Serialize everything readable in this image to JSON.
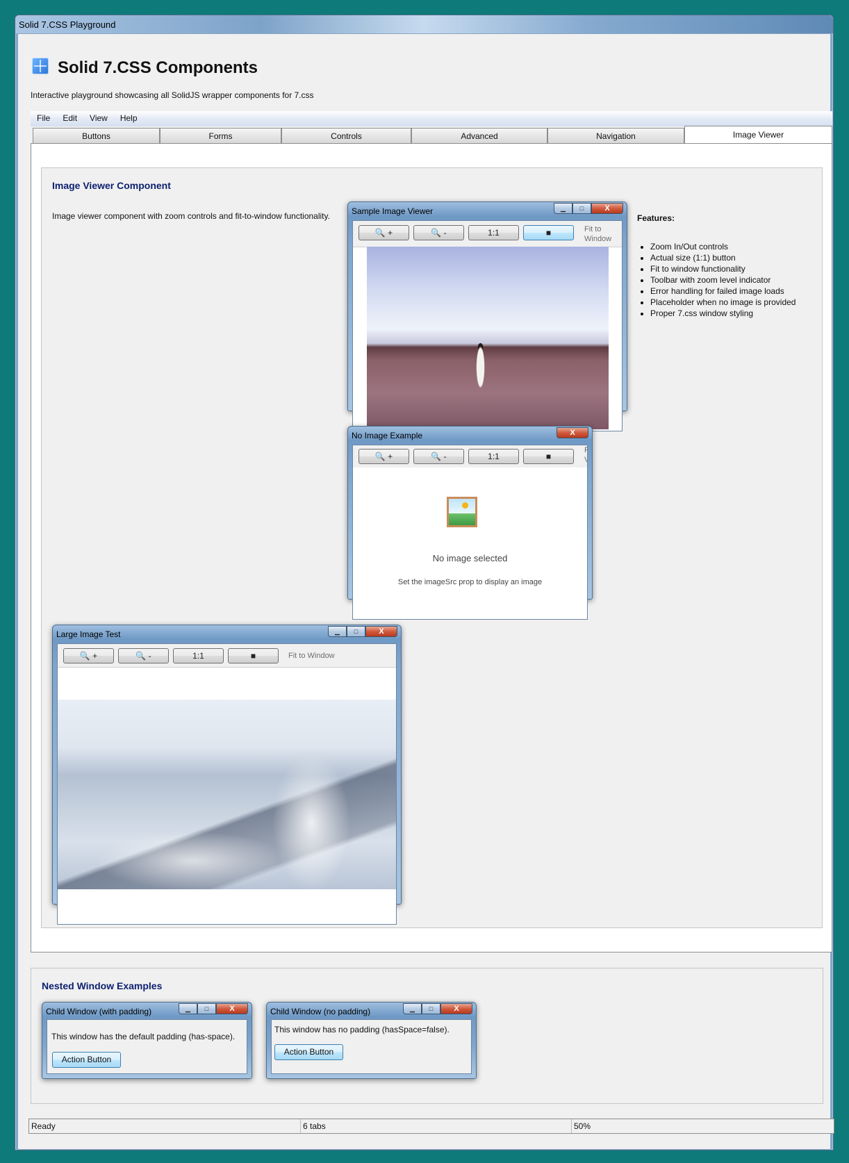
{
  "window": {
    "title": "Solid 7.CSS Playground"
  },
  "header": {
    "title": "Solid 7.CSS Components",
    "subtitle": "Interactive playground showcasing all SolidJS wrapper components for 7.css"
  },
  "menu": [
    "File",
    "Edit",
    "View",
    "Help"
  ],
  "tabs": [
    "Buttons",
    "Forms",
    "Controls",
    "Advanced",
    "Navigation",
    "Image Viewer"
  ],
  "active_tab": "Image Viewer",
  "image_viewer_section": {
    "title": "Image Viewer Component",
    "description": "Image viewer component with zoom controls and fit-to-window functionality."
  },
  "toolbar": {
    "zoom_in": "+",
    "zoom_out": "-",
    "actual_size": "1:1",
    "fit_icon": "■",
    "fit_label": "Fit to Window",
    "fit_label_wrap1": "Fit to",
    "fit_label_wrap2": "Window",
    "fit_trunc1": "F",
    "fit_trunc2": "V"
  },
  "windows": {
    "sample": {
      "title": "Sample Image Viewer"
    },
    "no_image": {
      "title": "No Image Example",
      "message": "No image selected",
      "hint": "Set the imageSrc prop to display an image"
    },
    "large": {
      "title": "Large Image Test"
    }
  },
  "features": {
    "heading": "Features:",
    "items": [
      "Zoom In/Out controls",
      "Actual size (1:1) button",
      "Fit to window functionality",
      "Toolbar with zoom level indicator",
      "Error handling for failed image loads",
      "Placeholder when no image is provided",
      "Proper 7.css window styling"
    ]
  },
  "nested": {
    "title": "Nested Window Examples",
    "child1": {
      "title": "Child Window (with padding)",
      "text": "This window has the default padding (has-space).",
      "button": "Action Button"
    },
    "child2": {
      "title": "Child Window (no padding)",
      "text": "This window has no padding (hasSpace=false).",
      "button": "Action Button"
    }
  },
  "window_controls": {
    "minimize": "▁",
    "maximize": "□",
    "close": "X"
  },
  "statusbar": {
    "status": "Ready",
    "tabs_count": "6 tabs",
    "zoom": "50%"
  }
}
